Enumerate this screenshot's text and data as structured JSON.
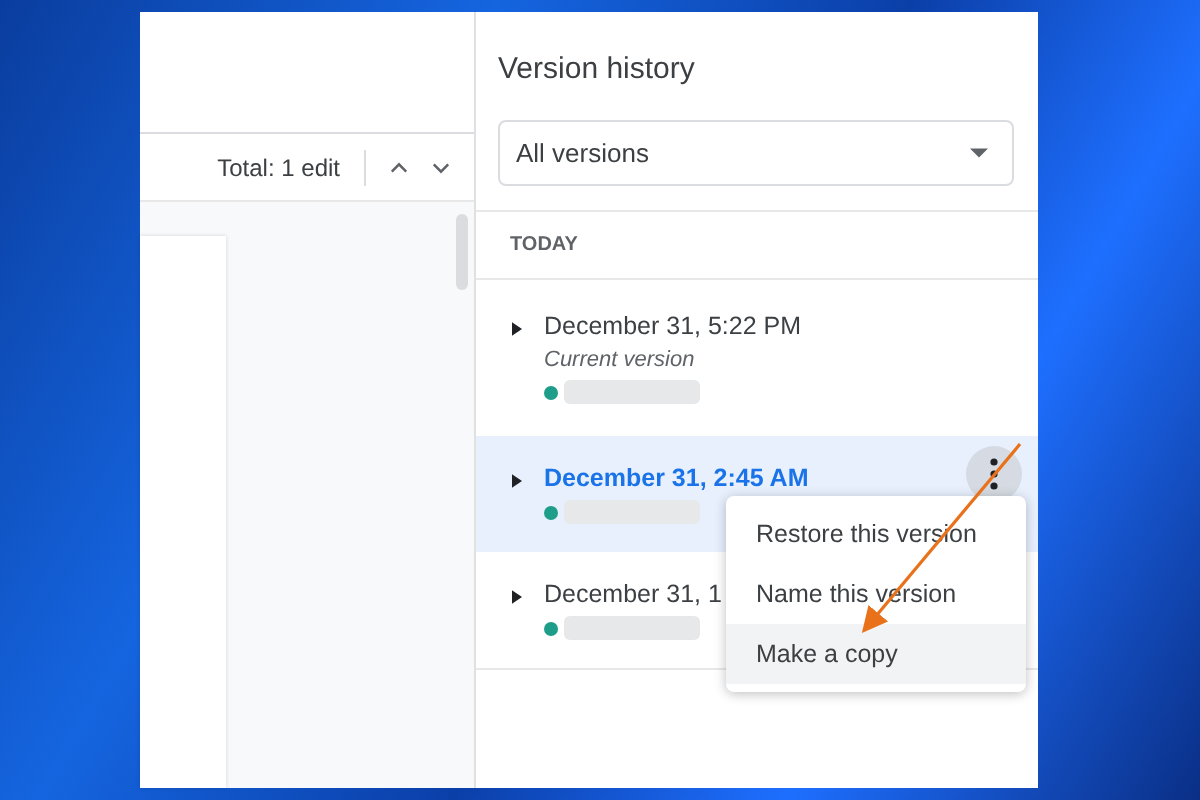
{
  "toolbar": {
    "edit_count": "Total: 1 edit"
  },
  "version_history": {
    "title": "Version history",
    "filter": {
      "value": "All versions"
    },
    "section": "TODAY",
    "versions": [
      {
        "time": "December 31, 5:22 PM",
        "label": "Current version",
        "selected": false
      },
      {
        "time": "December 31, 2:45 AM",
        "selected": true
      },
      {
        "time": "December 31, 1",
        "selected": false
      }
    ],
    "menu": {
      "items": [
        {
          "label": "Restore this version",
          "selected": false
        },
        {
          "label": "Name this version",
          "selected": false
        },
        {
          "label": "Make a copy",
          "selected": true
        }
      ]
    }
  }
}
